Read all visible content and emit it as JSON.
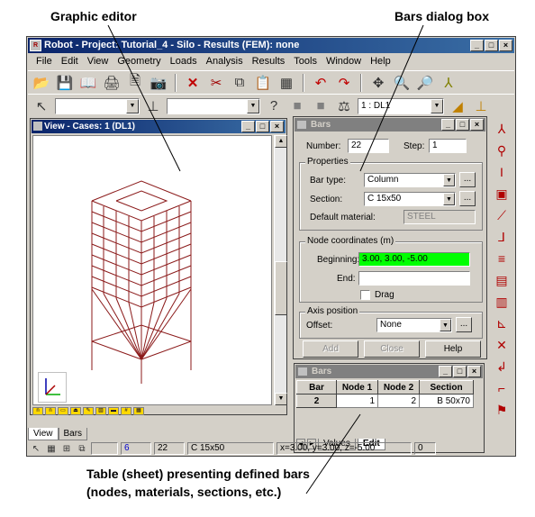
{
  "callouts": {
    "graphic_editor": "Graphic editor",
    "bars_dialog": "Bars dialog box",
    "table_line1": "Table (sheet) presenting defined bars",
    "table_line2": "(nodes, materials, sections, etc.)"
  },
  "app": {
    "title": "Robot - Project: Tutorial_4 - Silo - Results (FEM): none",
    "menu": [
      "File",
      "Edit",
      "View",
      "Geometry",
      "Loads",
      "Analysis",
      "Results",
      "Tools",
      "Window",
      "Help"
    ],
    "load_case_combo": "1 : DL1"
  },
  "view": {
    "title": "View - Cases: 1 (DL1)"
  },
  "bars_dialog": {
    "title": "Bars",
    "number_label": "Number:",
    "number_value": "22",
    "step_label": "Step:",
    "step_value": "1",
    "properties_label": "Properties",
    "bar_type_label": "Bar type:",
    "bar_type_value": "Column",
    "section_label": "Section:",
    "section_value": "C 15x50",
    "default_material_label": "Default material:",
    "default_material_value": "STEEL",
    "node_coords_label": "Node coordinates (m)",
    "beginning_label": "Beginning:",
    "beginning_value": "3.00, 3.00, -5.00",
    "end_label": "End:",
    "end_value": "",
    "drag_label": "Drag",
    "axis_position_label": "Axis position",
    "offset_label": "Offset:",
    "offset_value": "None",
    "ellipsis": "...",
    "add_label": "Add",
    "close_label": "Close",
    "help_label": "Help"
  },
  "bars_table": {
    "title": "Bars",
    "headers": [
      "Bar",
      "Node 1",
      "Node 2",
      "Section"
    ],
    "rows": [
      [
        "2",
        "1",
        "2",
        "B 50x70"
      ]
    ],
    "tabs": [
      "Values",
      "Edit"
    ]
  },
  "bottom_tabs": [
    "View",
    "Bars"
  ],
  "status": {
    "number": "22",
    "section": "C 15x50",
    "coords": "x=3.00, y=3.00, z=-5.00",
    "zero": "0"
  },
  "colors": {
    "title_active": "#0a246a",
    "frame_line": "#8b1a1a",
    "field_green": "#00ff00"
  }
}
